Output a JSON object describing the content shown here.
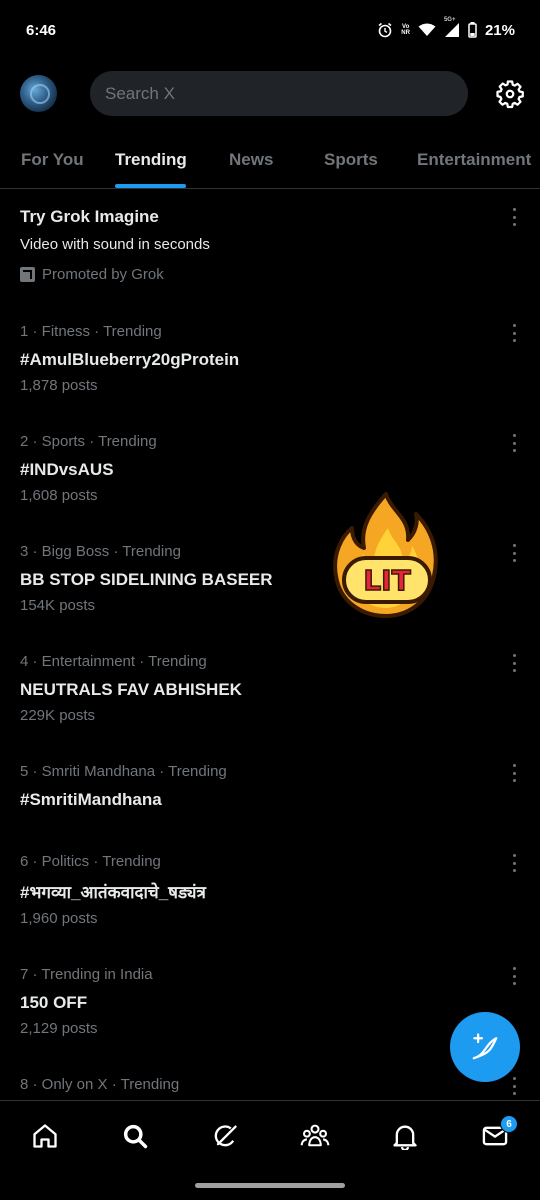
{
  "status_bar": {
    "time": "6:46",
    "network_top": "Vo",
    "network_bottom": "NR",
    "five_g": "5G+",
    "battery": "21%"
  },
  "header": {
    "search_placeholder": "Search X"
  },
  "tabs": [
    {
      "label": "For You",
      "active": false
    },
    {
      "label": "Trending",
      "active": true
    },
    {
      "label": "News",
      "active": false
    },
    {
      "label": "Sports",
      "active": false
    },
    {
      "label": "Entertainment",
      "active": false
    }
  ],
  "promo": {
    "title": "Try Grok Imagine",
    "description": "Video with sound in seconds",
    "promoted_by": "Promoted by Grok"
  },
  "trends": [
    {
      "meta": "1 · Fitness · Trending",
      "title": "#AmulBlueberry20gProtein",
      "count": "1,878 posts"
    },
    {
      "meta": "2 · Sports · Trending",
      "title": "#INDvsAUS",
      "count": "1,608 posts"
    },
    {
      "meta": "3 · Bigg Boss · Trending",
      "title": "BB STOP SIDELINING BASEER",
      "count": "154K posts"
    },
    {
      "meta": "4 · Entertainment · Trending",
      "title": "NEUTRALS FAV ABHISHEK",
      "count": "229K posts"
    },
    {
      "meta": "5 · Smriti Mandhana · Trending",
      "title": "#SmritiMandhana",
      "count": ""
    },
    {
      "meta": "6 · Politics · Trending",
      "title": "#भगव्या_आतंकवादाचे_षड्यंत्र",
      "count": "1,960 posts"
    },
    {
      "meta": "7 · Trending in India",
      "title": "150 OFF",
      "count": "2,129 posts"
    },
    {
      "meta": "8 · Only on X · Trending",
      "title": "",
      "count": ""
    }
  ],
  "sticker": {
    "text": "LIT"
  },
  "messages_badge": "6",
  "colors": {
    "accent": "#1d9bf0",
    "background": "#000000",
    "muted": "#71767b",
    "text": "#e7e9ea"
  },
  "bottom_nav": [
    {
      "icon": "home-icon"
    },
    {
      "icon": "search-icon"
    },
    {
      "icon": "grok-icon"
    },
    {
      "icon": "communities-icon"
    },
    {
      "icon": "notifications-icon"
    },
    {
      "icon": "messages-icon"
    }
  ]
}
